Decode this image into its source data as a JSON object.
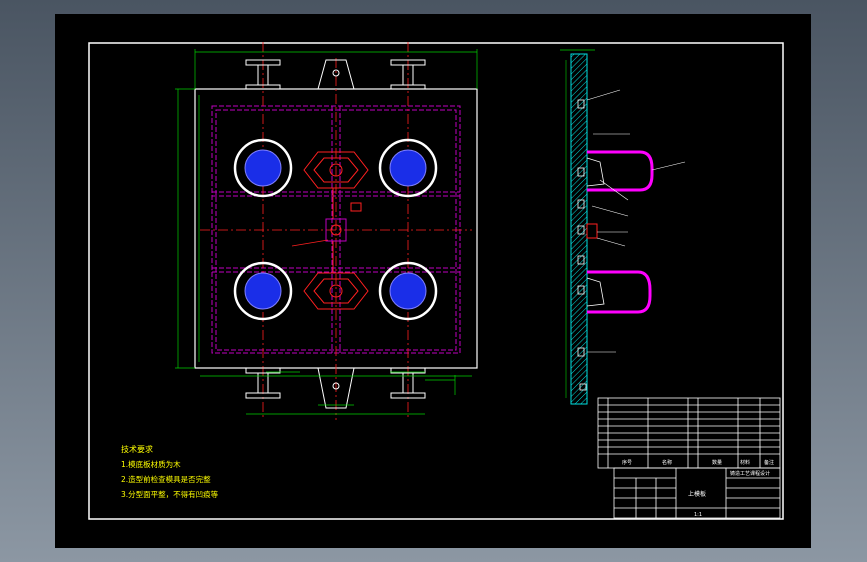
{
  "app": {
    "colors": {
      "background_outer_top": "#4a5562",
      "background_outer_bottom": "#8c97a3",
      "canvas": "#000000",
      "border": "#ffffff",
      "dimension": "#00d000",
      "outline": "#ffffff",
      "hidden_line": "#c000c0",
      "center_line": "#ff2020",
      "hole_fill": "#1a2ee8",
      "pipe": "#ff00ff",
      "section": "#00e0e0",
      "note_text": "#ffff00"
    }
  },
  "drawing": {
    "tech_requirements": {
      "title": "技术要求",
      "items": [
        "1.模底板材质为木",
        "2.造型前检查模具是否完整",
        "3.分型面平整，不得有凹痕等"
      ]
    },
    "annotations": {
      "plan_note": "",
      "section_label": ""
    },
    "bom_header": {
      "col_no": "序号",
      "col_name": "名称",
      "col_qty": "数量",
      "col_material": "材料",
      "col_remark": "备注"
    },
    "title_block": {
      "project": "铸造工艺课程设计",
      "drawing_name": "上模板",
      "scale": "1:1"
    }
  }
}
